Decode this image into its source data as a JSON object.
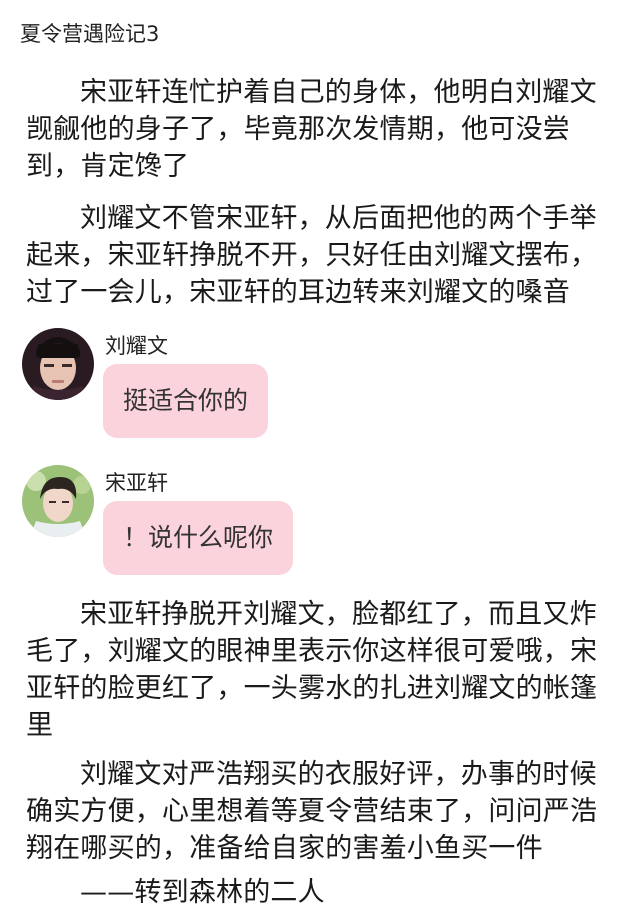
{
  "title": "夏令营遇险记3",
  "paragraphs": [
    "宋亚轩连忙护着自己的身体，他明白刘耀文觊觎他的身子了，毕竟那次发情期，他可没尝到，肯定馋了",
    "刘耀文不管宋亚轩，从后面把他的两个手举起来，宋亚轩挣脱不开，只好任由刘耀文摆布，过了一会儿，宋亚轩的耳边转来刘耀文的嗓音",
    "宋亚轩挣脱开刘耀文，脸都红了，而且又炸毛了，刘耀文的眼神里表示你这样很可爱哦，宋亚轩的脸更红了，一头雾水的扎进刘耀文的帐篷里",
    "刘耀文对严浩翔买的衣服好评，办事的时候确实方便，心里想着等夏令营结束了，问问严浩翔在哪买的，准备给自家的害羞小鱼买一件",
    "——转到森林的二人"
  ],
  "chat": [
    {
      "speaker": "刘耀文",
      "message": "挺适合你的",
      "bubble_color": "#fbd3dc"
    },
    {
      "speaker": "宋亚轩",
      "message": "！说什么呢你",
      "bubble_color": "#fbd3dc"
    }
  ]
}
